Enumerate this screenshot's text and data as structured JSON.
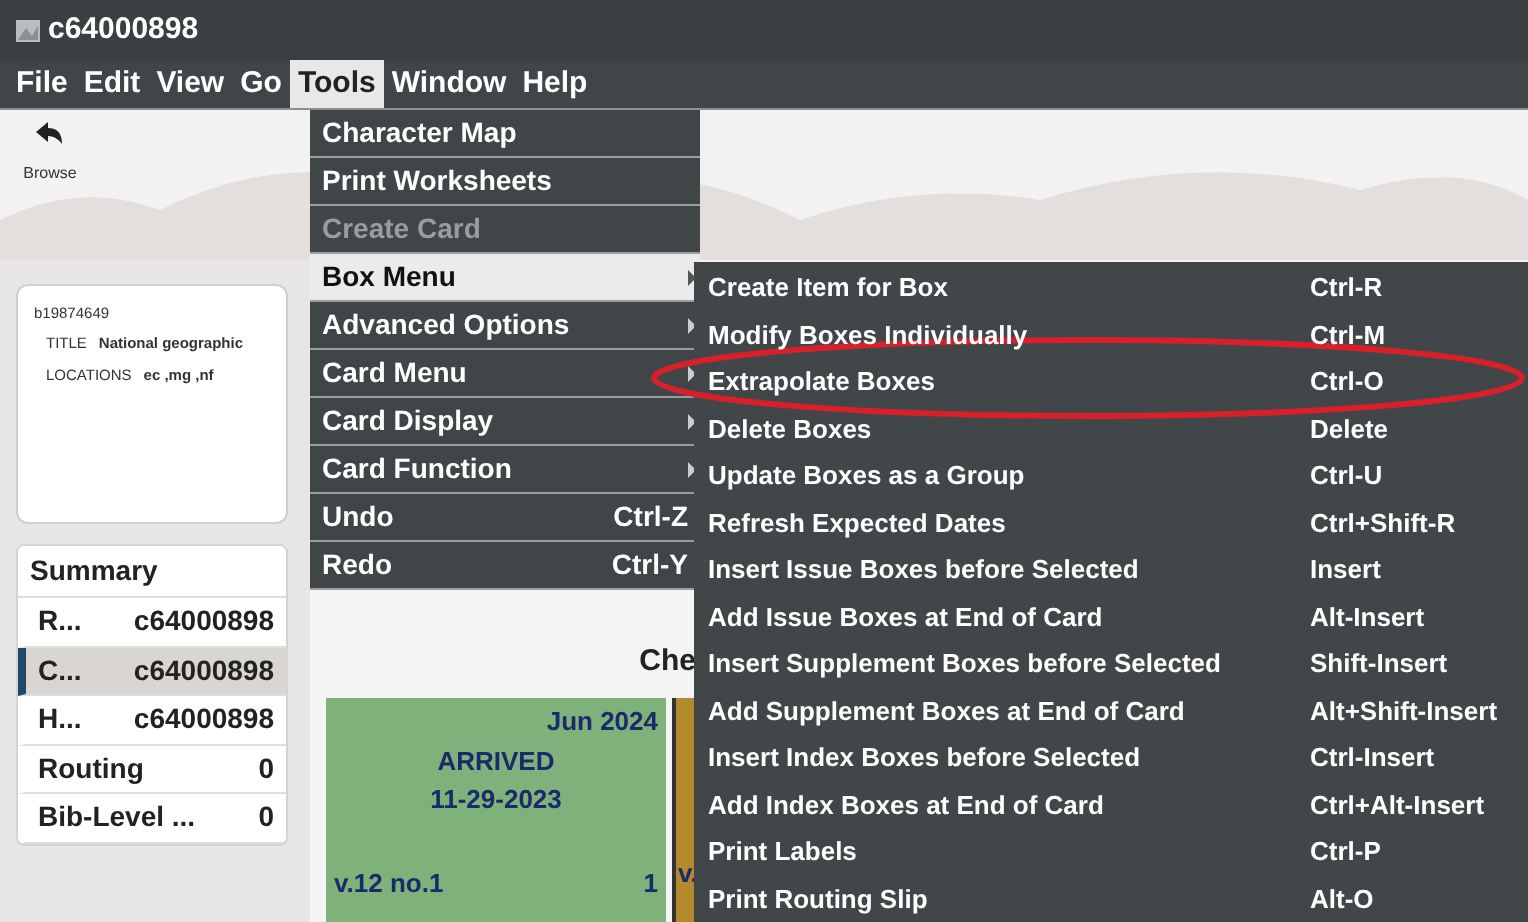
{
  "window": {
    "title": "c64000898"
  },
  "menubar": [
    {
      "label": "File",
      "selected": false
    },
    {
      "label": "Edit",
      "selected": false
    },
    {
      "label": "View",
      "selected": false
    },
    {
      "label": "Go",
      "selected": false
    },
    {
      "label": "Tools",
      "selected": true
    },
    {
      "label": "Window",
      "selected": false
    },
    {
      "label": "Help",
      "selected": false
    }
  ],
  "toolbar": {
    "browse": "Browse"
  },
  "tools_menu": [
    {
      "label": "Character Map",
      "submenu": false,
      "selected": false,
      "disabled": false
    },
    {
      "label": "Print Worksheets",
      "submenu": false,
      "selected": false,
      "disabled": false
    },
    {
      "label": "Create Card",
      "submenu": false,
      "selected": false,
      "disabled": true
    },
    {
      "label": "Box Menu",
      "submenu": true,
      "selected": true,
      "disabled": false
    },
    {
      "label": "Advanced Options",
      "submenu": true,
      "selected": false,
      "disabled": false
    },
    {
      "label": "Card Menu",
      "submenu": true,
      "selected": false,
      "disabled": false
    },
    {
      "label": "Card Display",
      "submenu": true,
      "selected": false,
      "disabled": false
    },
    {
      "label": "Card Function",
      "submenu": true,
      "selected": false,
      "disabled": false
    },
    {
      "label": "Undo",
      "shortcut": "Ctrl-Z",
      "submenu": false,
      "selected": false,
      "disabled": false
    },
    {
      "label": "Redo",
      "shortcut": "Ctrl-Y",
      "submenu": false,
      "selected": false,
      "disabled": false
    }
  ],
  "box_menu": [
    {
      "label": "Create Item for Box",
      "shortcut": "Ctrl-R"
    },
    {
      "label": "Modify Boxes Individually",
      "shortcut": "Ctrl-M"
    },
    {
      "label": "Extrapolate Boxes",
      "shortcut": "Ctrl-O"
    },
    {
      "label": "Delete Boxes",
      "shortcut": "Delete"
    },
    {
      "label": "Update Boxes as a Group",
      "shortcut": "Ctrl-U"
    },
    {
      "label": "Refresh Expected Dates",
      "shortcut": "Ctrl+Shift-R"
    },
    {
      "label": "Insert Issue Boxes before Selected",
      "shortcut": "Insert"
    },
    {
      "label": "Add Issue Boxes at End of Card",
      "shortcut": "Alt-Insert"
    },
    {
      "label": "Insert Supplement Boxes before Selected",
      "shortcut": "Shift-Insert"
    },
    {
      "label": "Add Supplement Boxes at End of Card",
      "shortcut": "Alt+Shift-Insert"
    },
    {
      "label": "Insert Index Boxes before Selected",
      "shortcut": "Ctrl-Insert"
    },
    {
      "label": "Add Index Boxes at End of Card",
      "shortcut": "Ctrl+Alt-Insert"
    },
    {
      "label": "Print Labels",
      "shortcut": "Ctrl-P"
    },
    {
      "label": "Print Routing Slip",
      "shortcut": "Alt-O"
    }
  ],
  "bib_card": {
    "record": "b19874649",
    "fields": [
      {
        "label": "TITLE",
        "value": "National geographic"
      },
      {
        "label": "LOCATIONS",
        "value": "ec ,mg ,nf"
      }
    ]
  },
  "summary": {
    "title": "Summary",
    "rows": [
      {
        "label": "R...",
        "value": "c64000898",
        "selected": false
      },
      {
        "label": "C...",
        "value": "c64000898",
        "selected": true
      },
      {
        "label": "H...",
        "value": "c64000898",
        "selected": false
      },
      {
        "label": "Routing",
        "value": "0",
        "selected": false
      },
      {
        "label": "Bib-Level ...",
        "value": "0",
        "selected": false
      }
    ]
  },
  "main": {
    "heading": "Che",
    "boxes": [
      {
        "kind": "arrived",
        "date": "Jun 2024",
        "status": "ARRIVED",
        "status_date": "11-29-2023",
        "volume": "v.12 no.1",
        "count": "1"
      },
      {
        "kind": "expected",
        "volume": "v."
      }
    ]
  }
}
